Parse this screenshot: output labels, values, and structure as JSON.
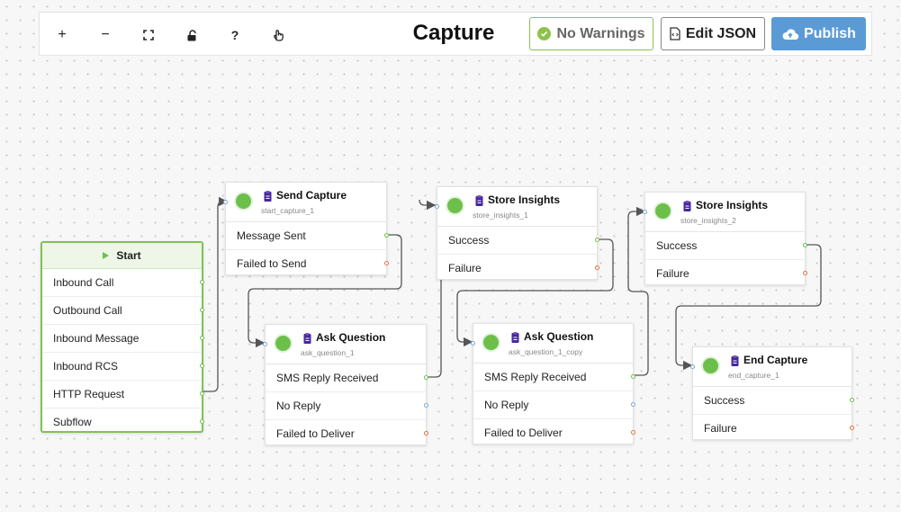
{
  "toolbar": {
    "title": "Capture",
    "zoom_in": "+",
    "zoom_out": "−",
    "fit": "⛶",
    "lock": "🔓",
    "help": "?",
    "pointer": "☝",
    "warnings_label": "No Warnings",
    "edit_json_label": "Edit JSON",
    "publish_label": "Publish"
  },
  "colors": {
    "accent_green": "#6cc04a",
    "publish_blue": "#5b9bd5",
    "port_blue": "#7aa6d6",
    "port_red": "#e2703b"
  },
  "nodes": {
    "start": {
      "title": "Start",
      "rows": [
        "Inbound Call",
        "Outbound Call",
        "Inbound Message",
        "Inbound RCS",
        "HTTP Request",
        "Subflow"
      ]
    },
    "send_capture": {
      "title": "Send Capture",
      "id": "start_capture_1",
      "rows": [
        "Message Sent",
        "Failed to Send"
      ]
    },
    "ask_question_1": {
      "title": "Ask Question",
      "id": "ask_question_1",
      "rows": [
        "SMS Reply Received",
        "No Reply",
        "Failed to Deliver"
      ]
    },
    "store_insights_1": {
      "title": "Store Insights",
      "id": "store_insights_1",
      "rows": [
        "Success",
        "Failure"
      ]
    },
    "ask_question_copy": {
      "title": "Ask Question",
      "id": "ask_question_1_copy",
      "rows": [
        "SMS Reply Received",
        "No Reply",
        "Failed to Deliver"
      ]
    },
    "store_insights_2": {
      "title": "Store Insights",
      "id": "store_insights_2",
      "rows": [
        "Success",
        "Failure"
      ]
    },
    "end_capture": {
      "title": "End Capture",
      "id": "end_capture_1",
      "rows": [
        "Success",
        "Failure"
      ]
    }
  }
}
